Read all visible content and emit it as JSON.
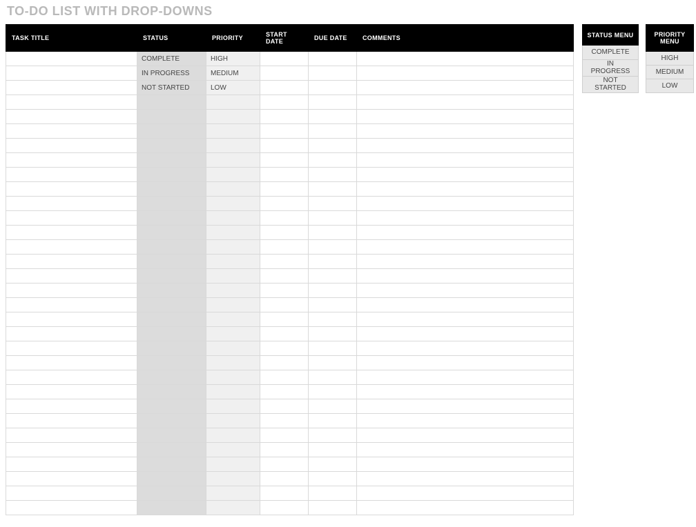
{
  "title": "TO-DO LIST WITH DROP-DOWNS",
  "columns": {
    "task": "TASK TITLE",
    "status": "STATUS",
    "priority": "PRIORITY",
    "start": "START DATE",
    "due": "DUE DATE",
    "comments": "COMMENTS"
  },
  "rows": [
    {
      "task": "",
      "status": "COMPLETE",
      "priority": "HIGH",
      "start": "",
      "due": "",
      "comments": ""
    },
    {
      "task": "",
      "status": "IN PROGRESS",
      "priority": "MEDIUM",
      "start": "",
      "due": "",
      "comments": ""
    },
    {
      "task": "",
      "status": "NOT STARTED",
      "priority": "LOW",
      "start": "",
      "due": "",
      "comments": ""
    },
    {
      "task": "",
      "status": "",
      "priority": "",
      "start": "",
      "due": "",
      "comments": ""
    },
    {
      "task": "",
      "status": "",
      "priority": "",
      "start": "",
      "due": "",
      "comments": ""
    },
    {
      "task": "",
      "status": "",
      "priority": "",
      "start": "",
      "due": "",
      "comments": ""
    },
    {
      "task": "",
      "status": "",
      "priority": "",
      "start": "",
      "due": "",
      "comments": ""
    },
    {
      "task": "",
      "status": "",
      "priority": "",
      "start": "",
      "due": "",
      "comments": ""
    },
    {
      "task": "",
      "status": "",
      "priority": "",
      "start": "",
      "due": "",
      "comments": ""
    },
    {
      "task": "",
      "status": "",
      "priority": "",
      "start": "",
      "due": "",
      "comments": ""
    },
    {
      "task": "",
      "status": "",
      "priority": "",
      "start": "",
      "due": "",
      "comments": ""
    },
    {
      "task": "",
      "status": "",
      "priority": "",
      "start": "",
      "due": "",
      "comments": ""
    },
    {
      "task": "",
      "status": "",
      "priority": "",
      "start": "",
      "due": "",
      "comments": ""
    },
    {
      "task": "",
      "status": "",
      "priority": "",
      "start": "",
      "due": "",
      "comments": ""
    },
    {
      "task": "",
      "status": "",
      "priority": "",
      "start": "",
      "due": "",
      "comments": ""
    },
    {
      "task": "",
      "status": "",
      "priority": "",
      "start": "",
      "due": "",
      "comments": ""
    },
    {
      "task": "",
      "status": "",
      "priority": "",
      "start": "",
      "due": "",
      "comments": ""
    },
    {
      "task": "",
      "status": "",
      "priority": "",
      "start": "",
      "due": "",
      "comments": ""
    },
    {
      "task": "",
      "status": "",
      "priority": "",
      "start": "",
      "due": "",
      "comments": ""
    },
    {
      "task": "",
      "status": "",
      "priority": "",
      "start": "",
      "due": "",
      "comments": ""
    },
    {
      "task": "",
      "status": "",
      "priority": "",
      "start": "",
      "due": "",
      "comments": ""
    },
    {
      "task": "",
      "status": "",
      "priority": "",
      "start": "",
      "due": "",
      "comments": ""
    },
    {
      "task": "",
      "status": "",
      "priority": "",
      "start": "",
      "due": "",
      "comments": ""
    },
    {
      "task": "",
      "status": "",
      "priority": "",
      "start": "",
      "due": "",
      "comments": ""
    },
    {
      "task": "",
      "status": "",
      "priority": "",
      "start": "",
      "due": "",
      "comments": ""
    },
    {
      "task": "",
      "status": "",
      "priority": "",
      "start": "",
      "due": "",
      "comments": ""
    },
    {
      "task": "",
      "status": "",
      "priority": "",
      "start": "",
      "due": "",
      "comments": ""
    },
    {
      "task": "",
      "status": "",
      "priority": "",
      "start": "",
      "due": "",
      "comments": ""
    },
    {
      "task": "",
      "status": "",
      "priority": "",
      "start": "",
      "due": "",
      "comments": ""
    },
    {
      "task": "",
      "status": "",
      "priority": "",
      "start": "",
      "due": "",
      "comments": ""
    },
    {
      "task": "",
      "status": "",
      "priority": "",
      "start": "",
      "due": "",
      "comments": ""
    },
    {
      "task": "",
      "status": "",
      "priority": "",
      "start": "",
      "due": "",
      "comments": ""
    }
  ],
  "status_menu": {
    "header": "STATUS MENU",
    "options": [
      "COMPLETE",
      "IN PROGRESS",
      "NOT STARTED"
    ]
  },
  "priority_menu": {
    "header": "PRIORITY MENU",
    "options": [
      "HIGH",
      "MEDIUM",
      "LOW"
    ]
  }
}
